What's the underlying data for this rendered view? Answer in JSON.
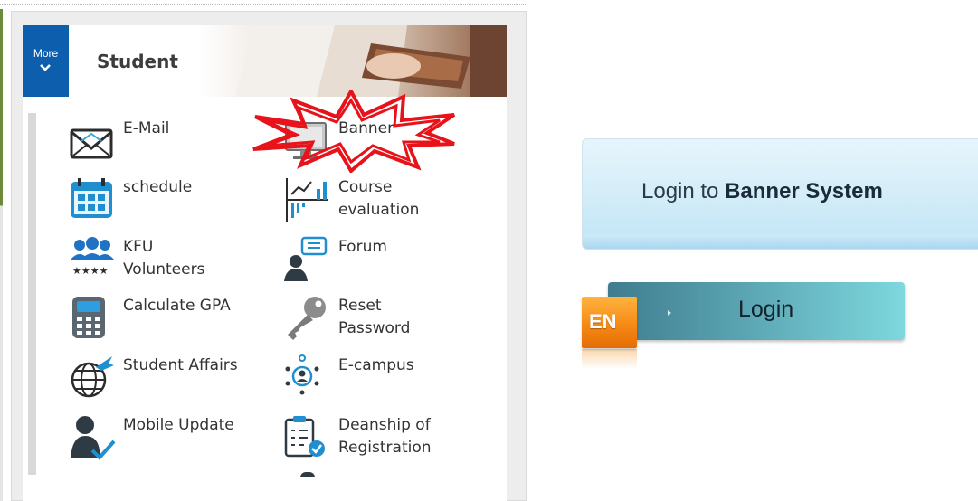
{
  "panel": {
    "more_label": "More",
    "title": "Student"
  },
  "menu": {
    "left": [
      {
        "label": "E-Mail",
        "icon": "envelope-icon"
      },
      {
        "label": "schedule",
        "icon": "calendar-icon"
      },
      {
        "label": "KFU\nVolunteers",
        "icon": "volunteers-icon"
      },
      {
        "label": "Calculate GPA",
        "icon": "calculator-icon"
      },
      {
        "label": "Student Affairs",
        "icon": "globe-plane-icon"
      },
      {
        "label": "Mobile Update",
        "icon": "user-check-icon"
      }
    ],
    "right": [
      {
        "label": "Banner",
        "icon": "computer-icon"
      },
      {
        "label": "Course\nevaluation",
        "icon": "chart-icon"
      },
      {
        "label": "Forum",
        "icon": "forum-icon"
      },
      {
        "label": "Reset\nPassword",
        "icon": "key-icon"
      },
      {
        "label": "E-campus",
        "icon": "network-user-icon"
      },
      {
        "label": "Deanship of\nRegistration",
        "icon": "checklist-icon"
      }
    ]
  },
  "banner_system": {
    "prefix": "Login to ",
    "name": "Banner System"
  },
  "login": {
    "button_label": "Login",
    "language_label": "EN"
  },
  "colors": {
    "more_button": "#0d5fad",
    "highlight_burst": "#e8121b",
    "login_button": "#5aa4b2",
    "language_button": "#f58a14"
  }
}
